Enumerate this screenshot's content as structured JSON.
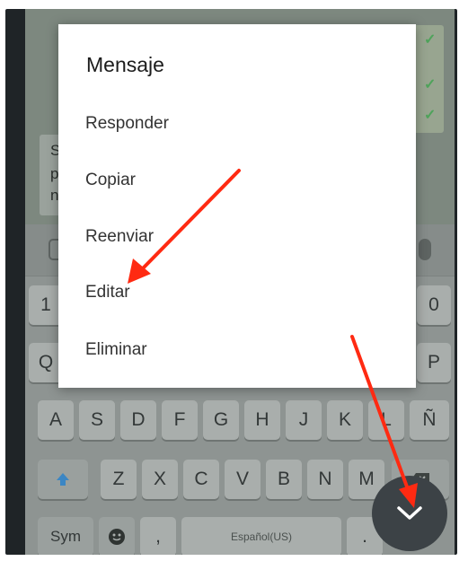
{
  "dialog": {
    "title": "Mensaje",
    "items": [
      {
        "label": "Responder"
      },
      {
        "label": "Copiar"
      },
      {
        "label": "Reenviar"
      },
      {
        "label": "Editar"
      },
      {
        "label": "Eliminar"
      }
    ]
  },
  "chat": {
    "left_bubble_letters": [
      "S",
      "p",
      "n"
    ]
  },
  "keyboard": {
    "number_row_visible": [
      "1",
      "0"
    ],
    "row_q_visible": [
      "Q",
      "P"
    ],
    "row_a": [
      "A",
      "S",
      "D",
      "F",
      "G",
      "H",
      "J",
      "K",
      "L",
      "Ñ"
    ],
    "row_z": [
      "Z",
      "X",
      "C",
      "V",
      "B",
      "N",
      "M"
    ],
    "sym_label": "Sym",
    "comma_label": ",",
    "space_label": "Español(US)",
    "period_label": "."
  },
  "icons": {
    "shift": "shift-arrow-icon",
    "backspace": "backspace-icon",
    "emoji": "emoji-icon",
    "mic": "microphone-icon",
    "fab": "chevron-down-icon"
  },
  "colors": {
    "annotation_arrow": "#ff2a12",
    "shift_icon": "#3b86c4",
    "fab_background": "#3c4246"
  }
}
